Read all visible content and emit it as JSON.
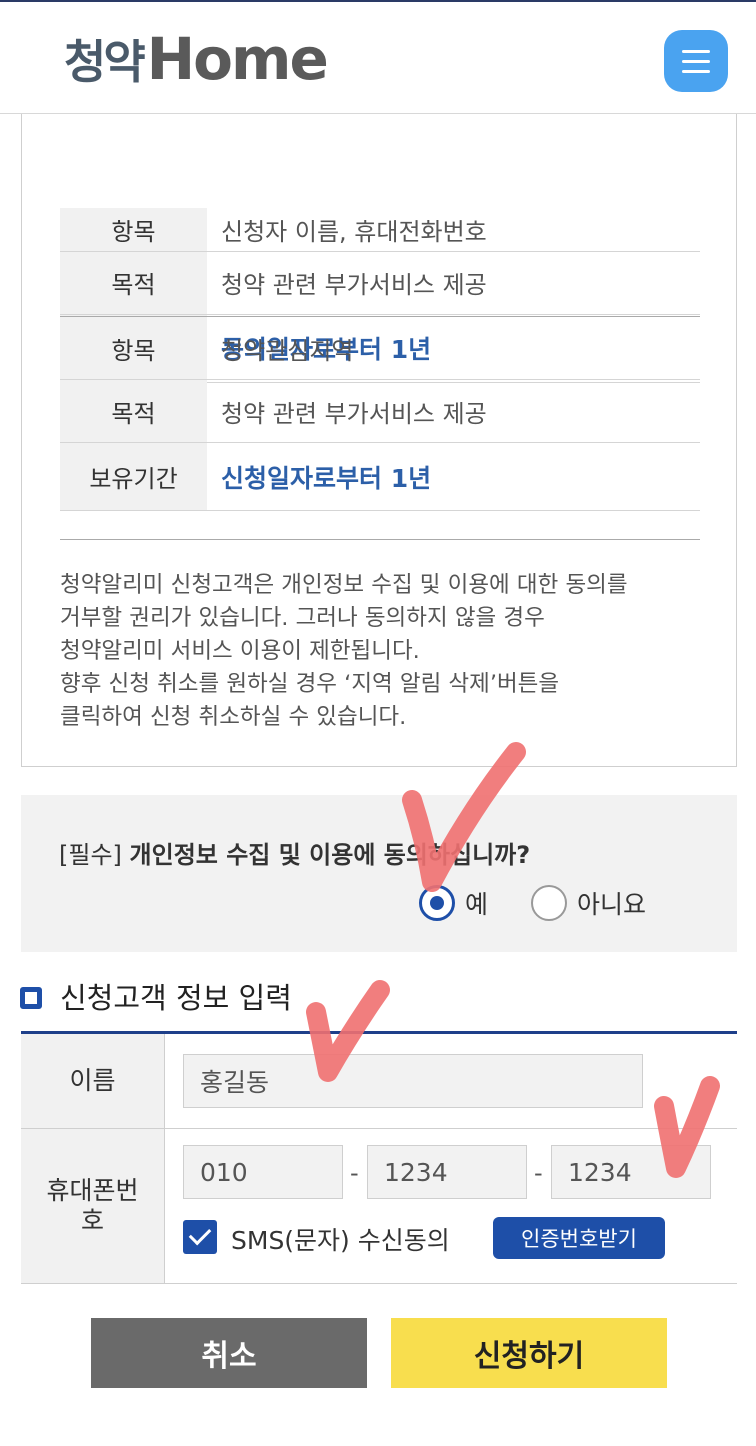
{
  "header": {
    "logo_kr": "청약",
    "logo_en": "Home",
    "menu_icon": "hamburger-menu-icon"
  },
  "consent_table_1": [
    {
      "key": "항목",
      "value": "신청자 이름, 휴대전화번호"
    },
    {
      "key": "목적",
      "value": "청약 관련 부가서비스 제공"
    },
    {
      "key": "보유기간",
      "value": "동의일자로부터 1년"
    }
  ],
  "consent_table_2": [
    {
      "key": "항목",
      "value": "청약관심지역"
    },
    {
      "key": "목적",
      "value": "청약 관련 부가서비스 제공"
    },
    {
      "key": "보유기간",
      "value": "신청일자로부터 1년"
    }
  ],
  "notice": [
    "청약알리미 신청고객은 개인정보 수집 및 이용에 대한 동의를",
    "거부할 권리가 있습니다. 그러나 동의하지 않을 경우",
    "청약알리미 서비스 이용이 제한됩니다.",
    "향후 신청 취소를 원하실 경우 ‘지역 알림 삭제’버튼을",
    "클릭하여 신청 취소하실 수 있습니다."
  ],
  "agreement": {
    "prefix": "[필수]",
    "question": "개인정보 수집 및 이용에 동의하십니까?",
    "yes_label": "예",
    "no_label": "아니요",
    "selected": "예"
  },
  "customer_form": {
    "section_title": "신청고객 정보 입력",
    "name_label": "이름",
    "name_value": "홍길동",
    "phone_label": "휴대폰번호",
    "phone_1": "010",
    "phone_2": "1234",
    "phone_3": "1234",
    "phone_sep": "-",
    "sms_label": "SMS(문자) 수신동의",
    "sms_checked": true,
    "cert_button": "인증번호받기"
  },
  "actions": {
    "cancel": "취소",
    "apply": "신청하기"
  },
  "colors": {
    "primary": "#1e4fa8",
    "highlight_text": "#2c5fa8",
    "apply_button": "#f8de4e",
    "cancel_button": "#6a6a6a",
    "annotation_mark": "#f07070"
  }
}
